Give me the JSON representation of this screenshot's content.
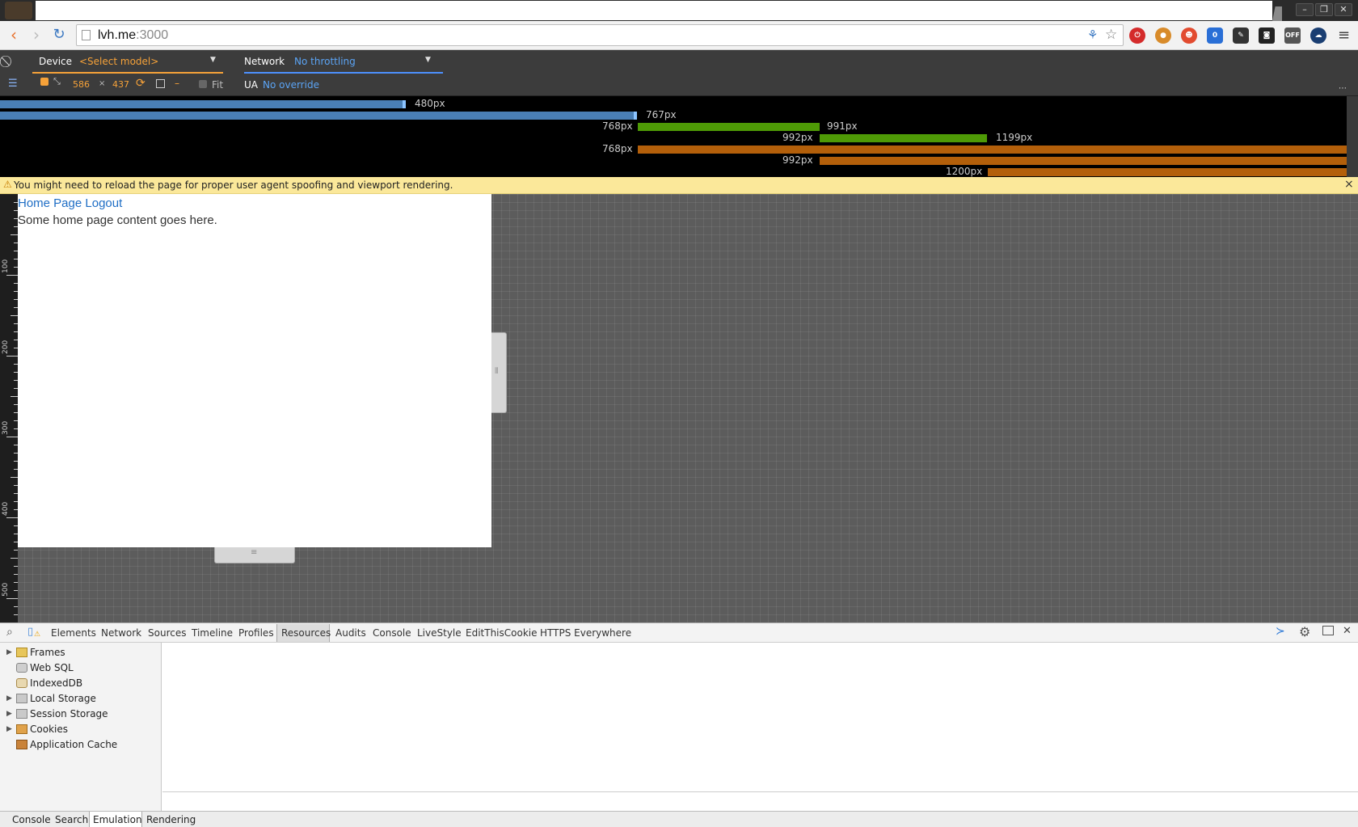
{
  "browser": {
    "url_host": "lvh.me",
    "url_port": ":3000",
    "window_buttons": [
      "–",
      "❐",
      "✕"
    ]
  },
  "emulation": {
    "device_label": "Device",
    "device_value": "<Select model>",
    "network_label": "Network",
    "network_value": "No throttling",
    "width": "586",
    "times": "×",
    "height": "437",
    "dash": "–",
    "fit_label": "Fit",
    "ua_label": "UA",
    "ua_value": "No override",
    "more": "⋮"
  },
  "media_queries": [
    {
      "label": "480px"
    },
    {
      "label": "767px"
    },
    {
      "label_left": "768px",
      "label_right": "991px"
    },
    {
      "label_left": "992px",
      "label_right": "1199px"
    },
    {
      "label_left": "768px"
    },
    {
      "label_left": "992px"
    },
    {
      "label_left": "1200px"
    }
  ],
  "warning": {
    "text": "You might need to reload the page for proper user agent spoofing and viewport rendering.",
    "close": "×"
  },
  "ruler": [
    "100",
    "200",
    "300",
    "400",
    "500"
  ],
  "page": {
    "link_home": "Home Page",
    "link_logout": "Logout",
    "content": "Some home page content goes here."
  },
  "devtools": {
    "tabs": [
      "Elements",
      "Network",
      "Sources",
      "Timeline",
      "Profiles",
      "Resources",
      "Audits",
      "Console",
      "LiveStyle",
      "EditThisCookie",
      "HTTPS Everywhere"
    ],
    "active_tab": "Resources",
    "tree": [
      "Frames",
      "Web SQL",
      "IndexedDB",
      "Local Storage",
      "Session Storage",
      "Cookies",
      "Application Cache"
    ],
    "drawer_tabs": [
      "Console",
      "Search",
      "Emulation",
      "Rendering"
    ],
    "active_drawer_tab": "Emulation"
  },
  "colors": {
    "accent_orange": "#f6a239",
    "accent_blue": "#5ba4f5",
    "mq_blue": "#4a7fb5",
    "mq_green": "#4e9a06",
    "mq_orange": "#b35f0a"
  }
}
